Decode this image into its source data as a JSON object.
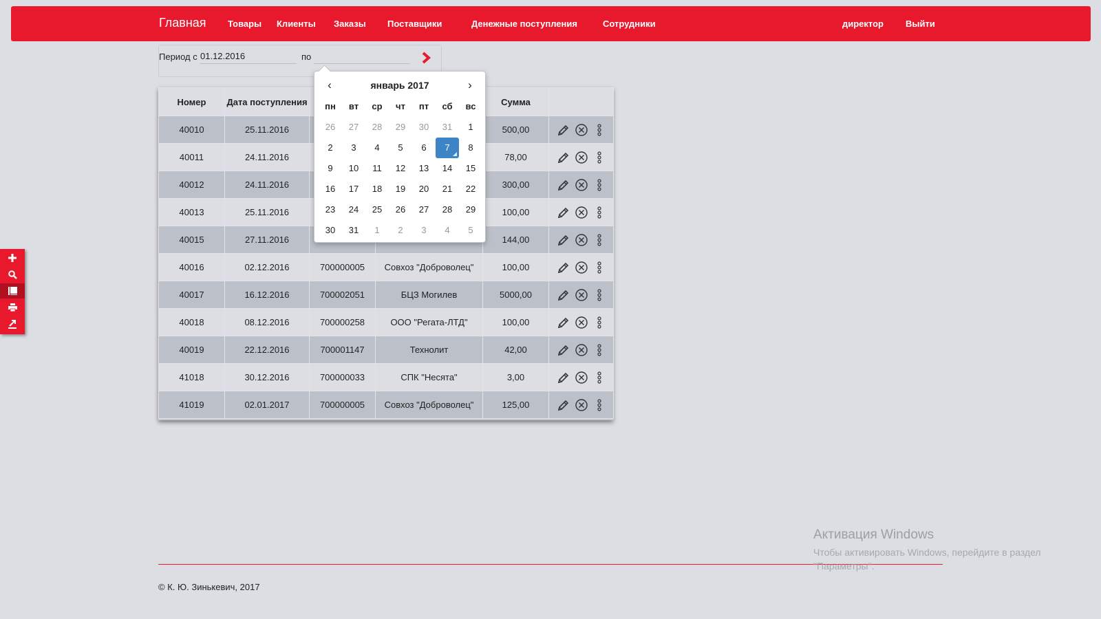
{
  "nav": {
    "brand": "Главная",
    "links": [
      "Товары",
      "Клиенты",
      "Заказы",
      "Поставщики",
      "Денежные поступления",
      "Сотрудники"
    ],
    "user": "директор",
    "logout": "Выйти"
  },
  "period": {
    "label_from": "Период с",
    "from_value": "01.12.2016",
    "label_to": "по",
    "to_value": ""
  },
  "table": {
    "headers": [
      "Номер",
      "Дата поступления",
      "",
      "",
      "Сумма",
      ""
    ],
    "rows": [
      [
        "40010",
        "25.11.2016",
        "",
        "",
        "500,00"
      ],
      [
        "40011",
        "24.11.2016",
        "",
        "",
        "78,00"
      ],
      [
        "40012",
        "24.11.2016",
        "",
        "",
        "300,00"
      ],
      [
        "40013",
        "25.11.2016",
        "",
        "",
        "100,00"
      ],
      [
        "40015",
        "27.11.2016",
        "",
        "",
        "144,00"
      ],
      [
        "40016",
        "02.12.2016",
        "700000005",
        "Совхоз \"Доброволец\"",
        "100,00"
      ],
      [
        "40017",
        "16.12.2016",
        "700002051",
        "БЦЗ Могилев",
        "5000,00"
      ],
      [
        "40018",
        "08.12.2016",
        "700000258",
        "ООО \"Регата-ЛТД\"",
        "100,00"
      ],
      [
        "40019",
        "22.12.2016",
        "700001147",
        "Технолит",
        "42,00"
      ],
      [
        "41018",
        "30.12.2016",
        "700000033",
        "СПК \"Несята\"",
        "3,00"
      ],
      [
        "41019",
        "02.01.2017",
        "700000005",
        "Совхоз \"Доброволец\"",
        "125,00"
      ]
    ]
  },
  "calendar": {
    "prev": "‹",
    "next": "›",
    "title": "январь 2017",
    "weekdays": [
      "пн",
      "вт",
      "ср",
      "чт",
      "пт",
      "сб",
      "вс"
    ],
    "days": [
      {
        "d": "26",
        "muted": true
      },
      {
        "d": "27",
        "muted": true
      },
      {
        "d": "28",
        "muted": true
      },
      {
        "d": "29",
        "muted": true
      },
      {
        "d": "30",
        "muted": true
      },
      {
        "d": "31",
        "muted": true
      },
      {
        "d": "1",
        "muted": false
      },
      {
        "d": "2",
        "muted": false
      },
      {
        "d": "3",
        "muted": false
      },
      {
        "d": "4",
        "muted": false
      },
      {
        "d": "5",
        "muted": false
      },
      {
        "d": "6",
        "muted": false
      },
      {
        "d": "7",
        "muted": false,
        "selected": true
      },
      {
        "d": "8",
        "muted": false
      },
      {
        "d": "9",
        "muted": false
      },
      {
        "d": "10",
        "muted": false
      },
      {
        "d": "11",
        "muted": false
      },
      {
        "d": "12",
        "muted": false
      },
      {
        "d": "13",
        "muted": false
      },
      {
        "d": "14",
        "muted": false
      },
      {
        "d": "15",
        "muted": false
      },
      {
        "d": "16",
        "muted": false
      },
      {
        "d": "17",
        "muted": false
      },
      {
        "d": "18",
        "muted": false
      },
      {
        "d": "19",
        "muted": false
      },
      {
        "d": "20",
        "muted": false
      },
      {
        "d": "21",
        "muted": false
      },
      {
        "d": "22",
        "muted": false
      },
      {
        "d": "23",
        "muted": false
      },
      {
        "d": "24",
        "muted": false
      },
      {
        "d": "25",
        "muted": false
      },
      {
        "d": "26",
        "muted": false
      },
      {
        "d": "27",
        "muted": false
      },
      {
        "d": "28",
        "muted": false
      },
      {
        "d": "29",
        "muted": false
      },
      {
        "d": "30",
        "muted": false
      },
      {
        "d": "31",
        "muted": false
      },
      {
        "d": "1",
        "muted": true
      },
      {
        "d": "2",
        "muted": true
      },
      {
        "d": "3",
        "muted": true
      },
      {
        "d": "4",
        "muted": true
      },
      {
        "d": "5",
        "muted": true
      }
    ]
  },
  "side_toolbar": {
    "icons": [
      "plus-icon",
      "search-icon",
      "list-icon",
      "print-icon",
      "export-icon"
    ],
    "active_index": 2
  },
  "row_actions": [
    "edit-icon",
    "delete-icon",
    "more-icon"
  ],
  "footer": {
    "copyright": "© К. Ю. Зинькевич, 2017"
  },
  "watermark": {
    "title": "Активация Windows",
    "subtitle": "Чтобы активировать Windows, перейдите в раздел \"Параметры\"."
  },
  "colors": {
    "accent": "#e8192c",
    "selected_day": "#3d85c6",
    "page_bg": "#dcdee3",
    "row_alt": "#bcc0c9"
  }
}
